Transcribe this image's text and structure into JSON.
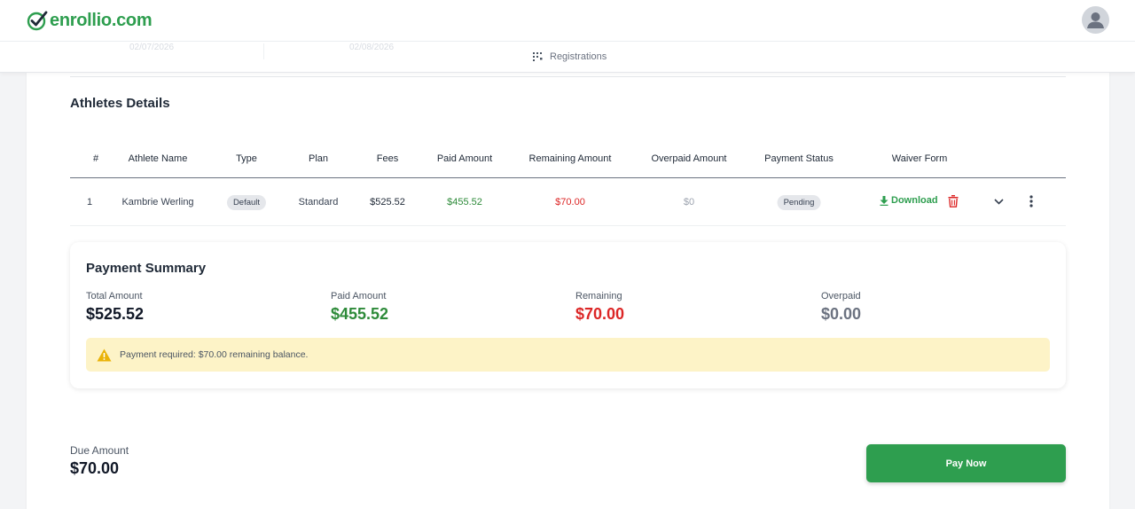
{
  "header": {
    "logo_text": "enrollio.com",
    "brand_color": "#2e9e4f",
    "avatar_icon": "user-avatar-icon"
  },
  "subnav": {
    "ghost_dates": [
      "02/07/2026",
      "02/08/2026"
    ],
    "registrations_label": "Registrations",
    "registrations_icon": "grid-dots-icon"
  },
  "athletes": {
    "title": "Athletes Details",
    "columns": [
      "#",
      "Athlete Name",
      "Type",
      "Plan",
      "Fees",
      "Paid Amount",
      "Remaining Amount",
      "Overpaid Amount",
      "Payment Status",
      "Waiver Form"
    ],
    "rows": [
      {
        "index": "1",
        "name": "Kambrie Werling",
        "type": "Default",
        "plan": "Standard",
        "fees": "$525.52",
        "paid": "$455.52",
        "remaining": "$70.00",
        "overpaid": "$0",
        "status": "Pending",
        "waiver_label": "Download"
      }
    ]
  },
  "summary": {
    "title": "Payment Summary",
    "total_label": "Total Amount",
    "total_value": "$525.52",
    "paid_label": "Paid Amount",
    "paid_value": "$455.52",
    "remaining_label": "Remaining",
    "remaining_value": "$70.00",
    "overpaid_label": "Overpaid",
    "overpaid_value": "$0.00",
    "alert_text": "Payment required: $70.00 remaining balance.",
    "colors": {
      "paid": "#2e8b3a",
      "remaining": "#dc2626",
      "overpaid": "#6b7280",
      "alert_bg": "#fdf3c7",
      "warning": "#eab308"
    }
  },
  "footer": {
    "due_label": "Due Amount",
    "due_value": "$70.00",
    "pay_button": "Pay Now"
  }
}
